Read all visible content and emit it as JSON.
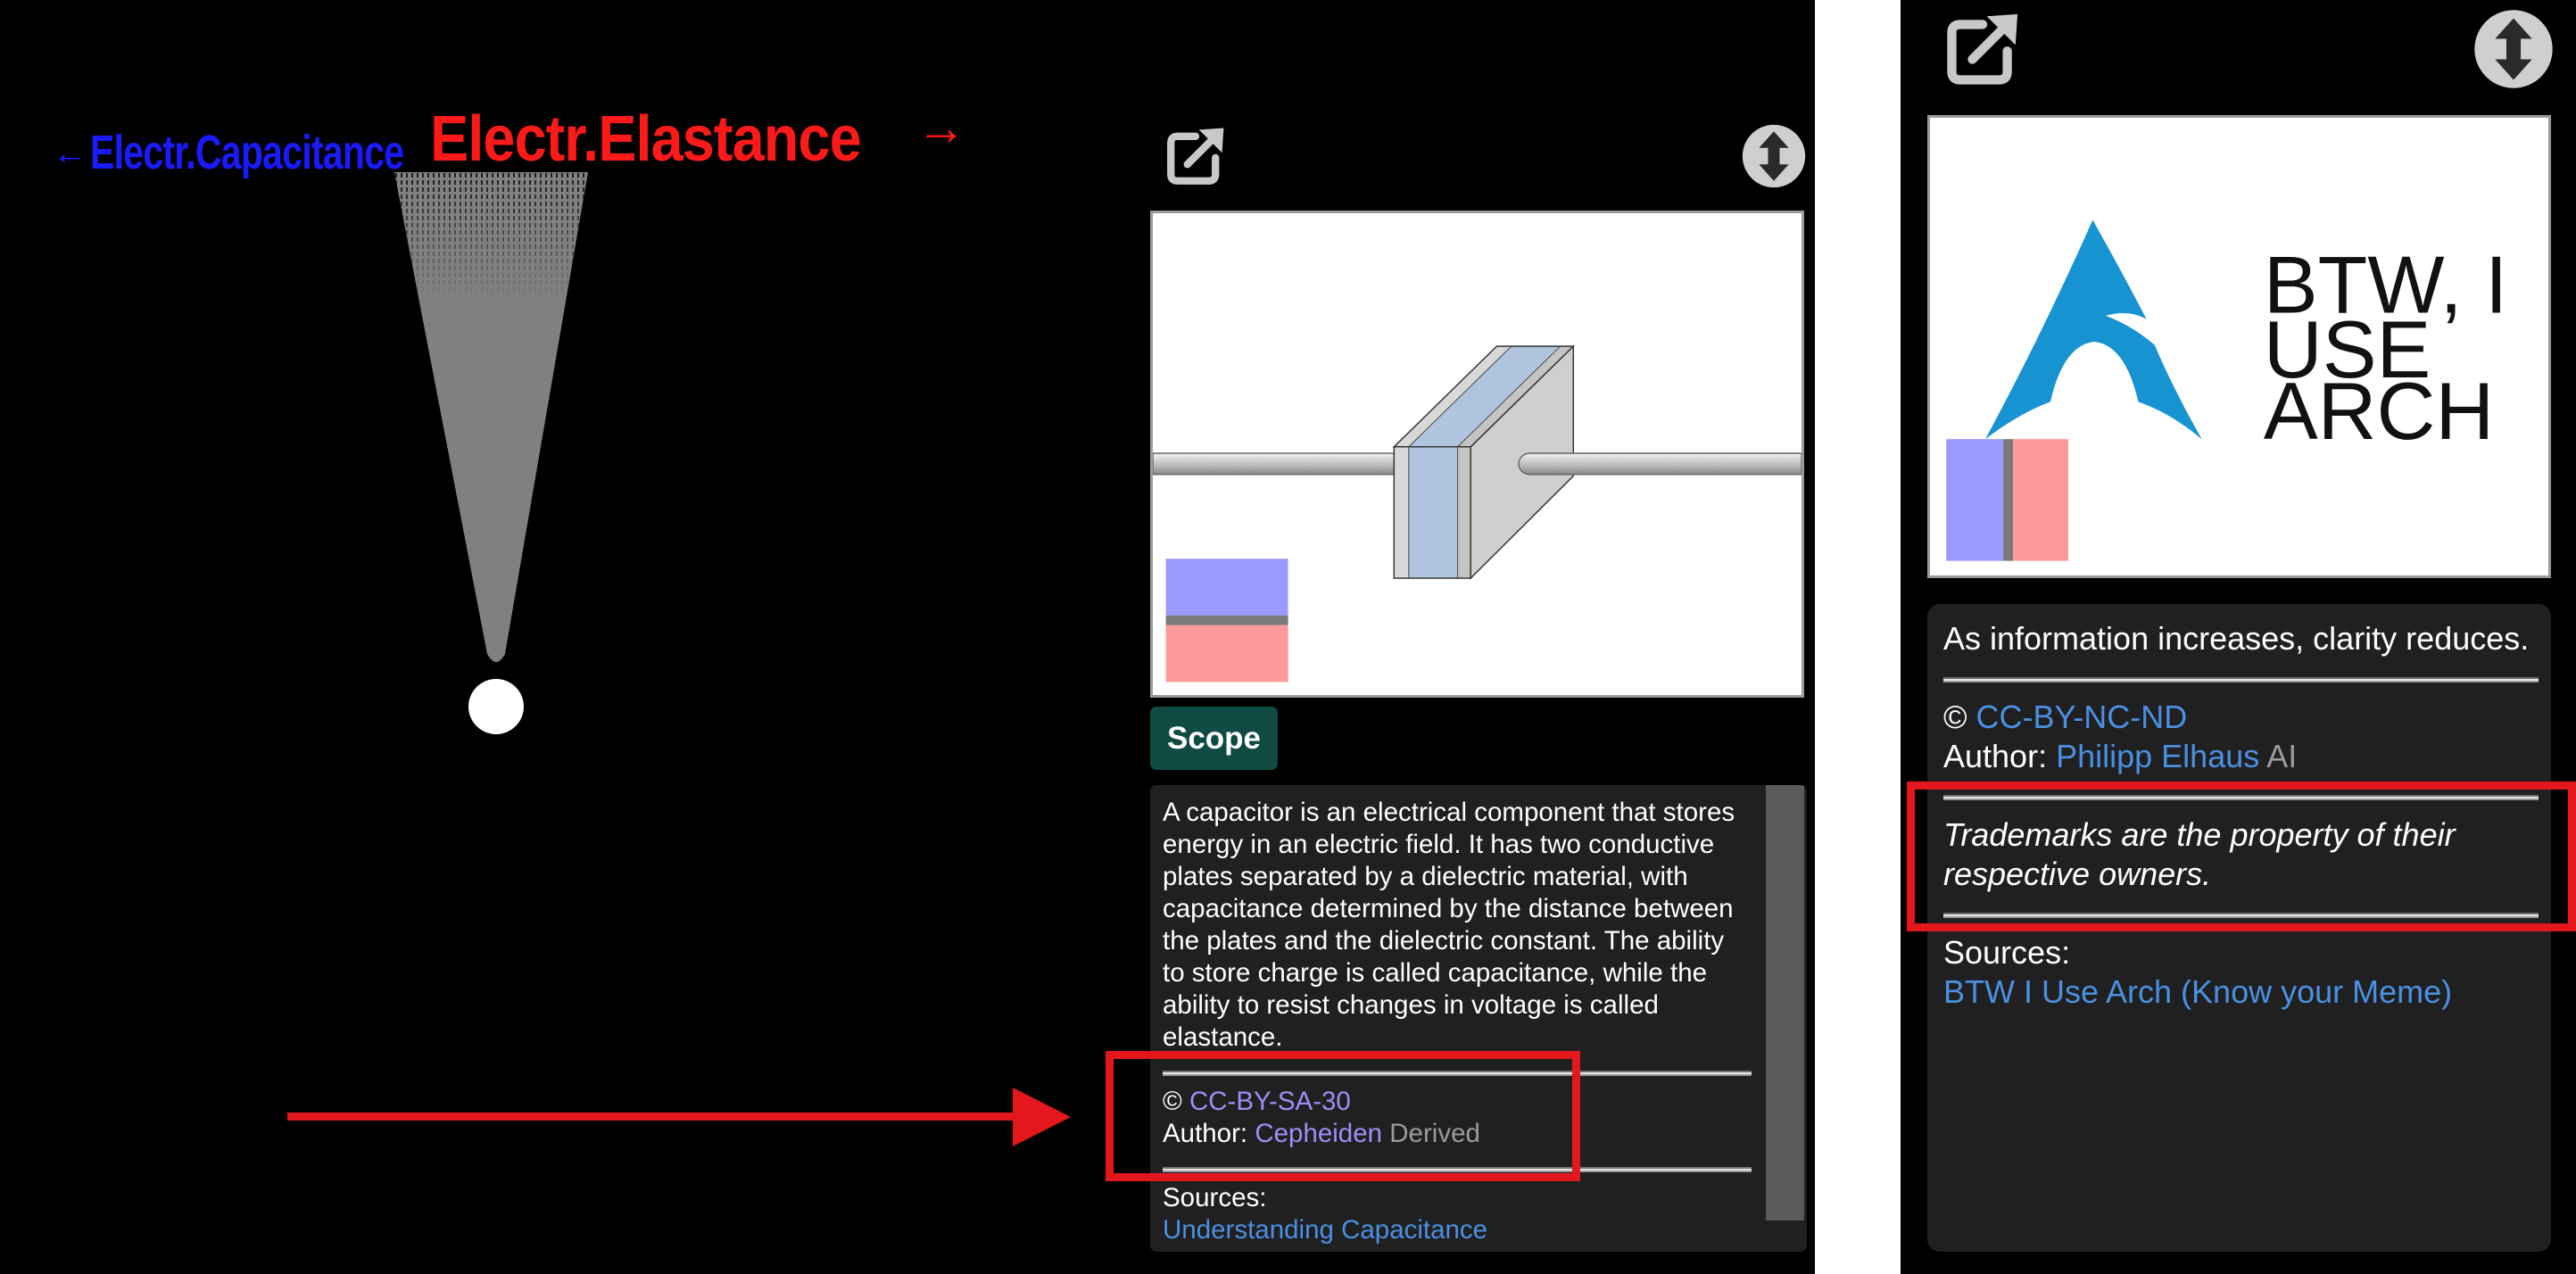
{
  "left_panel": {
    "nav": {
      "prev_arrow": "←",
      "prev_label": "Electr.Capacitance",
      "current_label": "Electr.Elastance",
      "next_arrow": "→"
    },
    "scope_button": "Scope",
    "description": "A capacitor is an electrical component that stores energy in an electric field. It has two conductive plates separated by a dielectric material, with capacitance determined by the distance between the plates and the dielectric constant. The ability to store charge is called capacitance, while the ability to resist changes in voltage is called elastance.",
    "license": {
      "symbol": "©",
      "name": "CC-BY-SA-30"
    },
    "author": {
      "label": "Author:",
      "name": "Cepheiden",
      "note": "Derived"
    },
    "sources": {
      "label": "Sources:",
      "links": [
        "Understanding Capacitance"
      ]
    }
  },
  "right_panel": {
    "image_text": [
      "BTW, I",
      "USE",
      "ARCH"
    ],
    "caption": "As information increases, clarity reduces.",
    "license": {
      "symbol": "©",
      "name": "CC-BY-NC-ND"
    },
    "author": {
      "label": "Author:",
      "name": "Philipp Elhaus",
      "note": "AI"
    },
    "disclaimer": "Trademarks are the property of their respective owners.",
    "sources": {
      "label": "Sources:",
      "links": [
        "BTW I Use Arch (Know your Meme)"
      ]
    }
  },
  "icons": {
    "open_external": "external-link-icon",
    "toggle_size": "up-down-arrows-icon",
    "left_image": "capacitor-illustration",
    "right_image": "arch-linux-logo"
  },
  "colors": {
    "prev_link": "#1a1aff",
    "current_topic": "#ff1a1a",
    "visited_link": "#a08cf5",
    "link": "#4a90e2",
    "muted": "#9a9a9a",
    "scope_button_bg": "#0f4b43",
    "highlight": "#e3171c",
    "arch_blue": "#1793d1",
    "swatch_blue": "#9999ff",
    "swatch_gray": "#7a7a7a",
    "swatch_pink": "#ff9999"
  }
}
